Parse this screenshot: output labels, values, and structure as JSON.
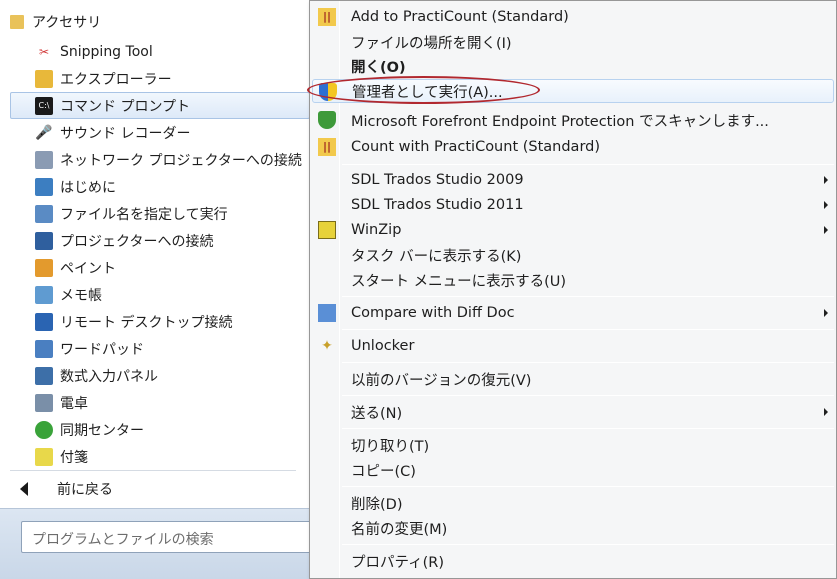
{
  "start_menu": {
    "folder": {
      "label": "アクセサリ",
      "icon": "folder-icon"
    },
    "programs": [
      {
        "label": "Snipping Tool",
        "icon": "scissors-icon",
        "color": "#d23c3c"
      },
      {
        "label": "エクスプローラー",
        "icon": "explorer-folder-icon",
        "color": "#e8b83a"
      },
      {
        "label": "コマンド プロンプト",
        "icon": "command-prompt-icon",
        "color": "#1a1a1a",
        "selected": true
      },
      {
        "label": "サウンド レコーダー",
        "icon": "microphone-icon",
        "color": "#444444"
      },
      {
        "label": "ネットワーク プロジェクターへの接続",
        "icon": "network-projector-icon",
        "color": "#6b7f99"
      },
      {
        "label": "はじめに",
        "icon": "getting-started-icon",
        "color": "#3c7ec1"
      },
      {
        "label": "ファイル名を指定して実行",
        "icon": "run-icon",
        "color": "#5a8bc4"
      },
      {
        "label": "プロジェクターへの接続",
        "icon": "projector-icon",
        "color": "#2f5f9e"
      },
      {
        "label": "ペイント",
        "icon": "paint-icon",
        "color": "#e39a2d"
      },
      {
        "label": "メモ帳",
        "icon": "notepad-icon",
        "color": "#5f9bd1"
      },
      {
        "label": "リモート デスクトップ接続",
        "icon": "remote-desktop-icon",
        "color": "#2a64b2"
      },
      {
        "label": "ワードパッド",
        "icon": "wordpad-icon",
        "color": "#4a7fc1"
      },
      {
        "label": "数式入力パネル",
        "icon": "math-input-icon",
        "color": "#3d6fa8"
      },
      {
        "label": "電卓",
        "icon": "calculator-icon",
        "color": "#7a8fa8"
      },
      {
        "label": "同期センター",
        "icon": "sync-center-icon",
        "color": "#3aa33a"
      },
      {
        "label": "付箋",
        "icon": "sticky-notes-icon",
        "color": "#e8d84a"
      }
    ],
    "back_label": "前に戻る",
    "search_placeholder": "プログラムとファイルの検索"
  },
  "context_menu": {
    "items": [
      {
        "label": "Add to PractiCount (Standard)",
        "icon": "practicount-icon"
      },
      {
        "label": "ファイルの場所を開く(I)"
      },
      {
        "label": "開く(O)",
        "bold": true
      },
      {
        "label": "管理者として実行(A)...",
        "icon": "uac-shield-icon",
        "highlighted": true
      },
      {
        "label": "Microsoft Forefront Endpoint Protection でスキャンします...",
        "icon": "forefront-shield-icon"
      },
      {
        "label": "Count with PractiCount (Standard)",
        "icon": "practicount-icon"
      },
      {
        "label": "SDL Trados Studio 2009",
        "submenu": true
      },
      {
        "label": "SDL Trados Studio 2011",
        "submenu": true
      },
      {
        "label": "WinZip",
        "icon": "winzip-icon",
        "submenu": true
      },
      {
        "label": "タスク バーに表示する(K)"
      },
      {
        "label": "スタート メニューに表示する(U)"
      },
      {
        "label": "Compare with Diff Doc",
        "icon": "diff-doc-icon",
        "submenu": true
      },
      {
        "label": "Unlocker",
        "icon": "unlocker-wand-icon"
      },
      {
        "label": "以前のバージョンの復元(V)"
      },
      {
        "label": "送る(N)",
        "submenu": true
      },
      {
        "label": "切り取り(T)"
      },
      {
        "label": "コピー(C)"
      },
      {
        "label": "削除(D)"
      },
      {
        "label": "名前の変更(M)"
      },
      {
        "label": "プロパティ(R)"
      }
    ]
  },
  "colors": {
    "highlight_border": "#b8d2ef",
    "annotation_oval": "#b1282f"
  }
}
